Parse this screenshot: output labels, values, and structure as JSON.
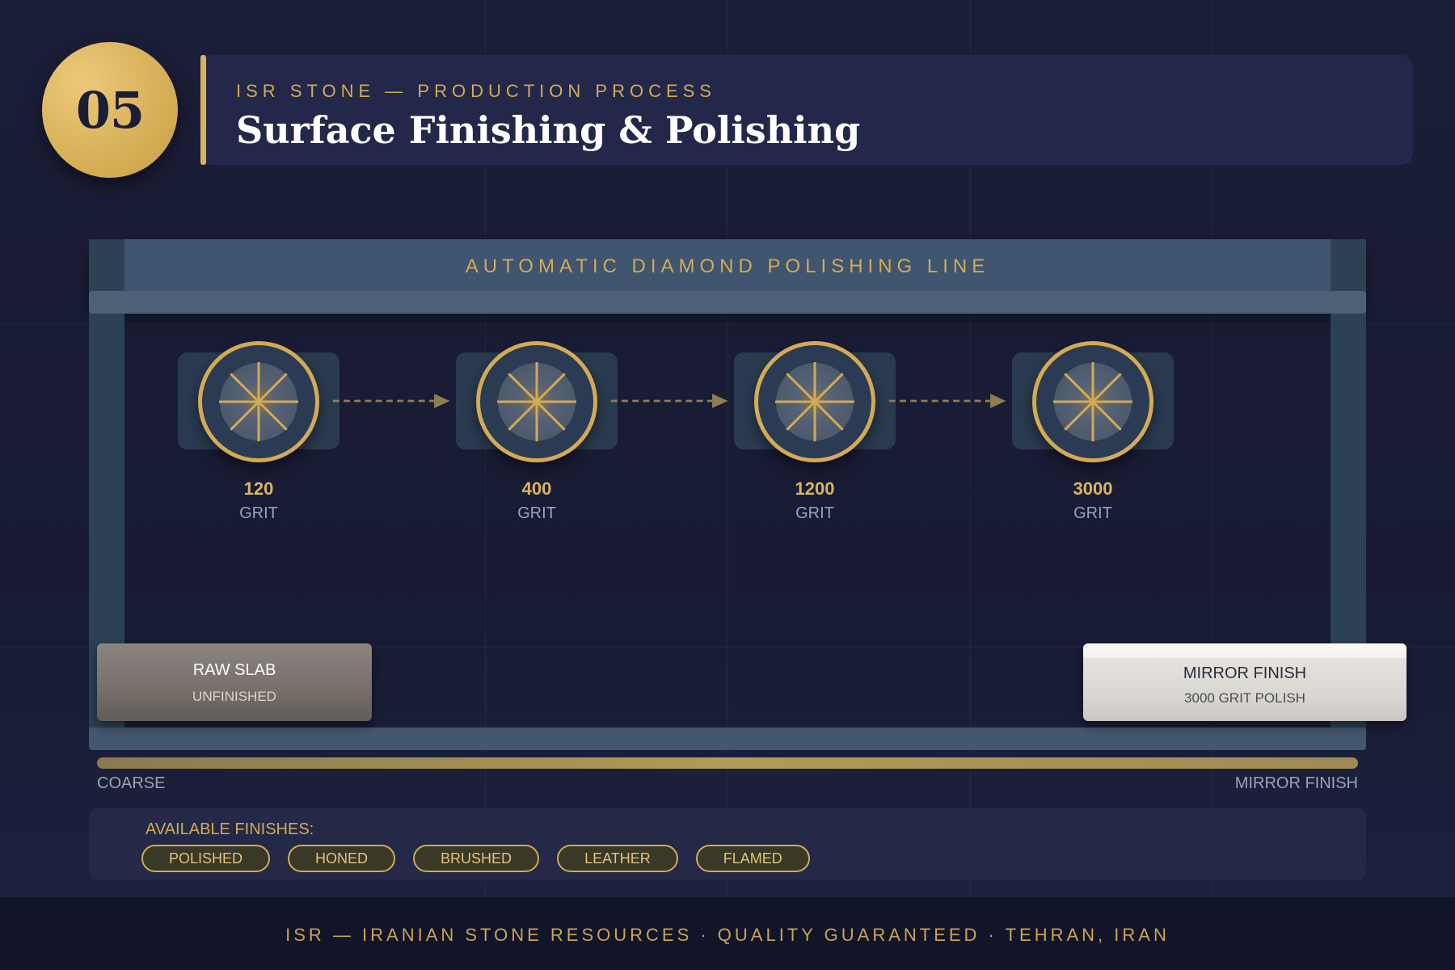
{
  "header": {
    "step_number": "05",
    "eyebrow": "ISR STONE — PRODUCTION PROCESS",
    "title": "Surface Finishing & Polishing"
  },
  "machine": {
    "label": "AUTOMATIC DIAMOND POLISHING LINE",
    "heads": [
      {
        "grit": "120",
        "unit": "GRIT"
      },
      {
        "grit": "400",
        "unit": "GRIT"
      },
      {
        "grit": "1200",
        "unit": "GRIT"
      },
      {
        "grit": "3000",
        "unit": "GRIT"
      }
    ]
  },
  "raw_slab": {
    "title": "RAW SLAB",
    "subtitle": "UNFINISHED"
  },
  "finished_slab": {
    "title": "MIRROR FINISH",
    "subtitle": "3000 GRIT POLISH"
  },
  "scale": {
    "left_label": "COARSE",
    "right_label": "MIRROR FINISH"
  },
  "finishes": {
    "title": "AVAILABLE FINISHES:",
    "items": [
      "POLISHED",
      "HONED",
      "BRUSHED",
      "LEATHER",
      "FLAMED"
    ]
  },
  "footer": {
    "text": "ISR — IRANIAN STONE RESOURCES · QUALITY GUARANTEED · TEHRAN, IRAN"
  },
  "colors": {
    "background": "#1b1e37",
    "gold": "#d4aa55",
    "machine_frame": "#3f5570",
    "machine_leg": "#2d4154"
  }
}
